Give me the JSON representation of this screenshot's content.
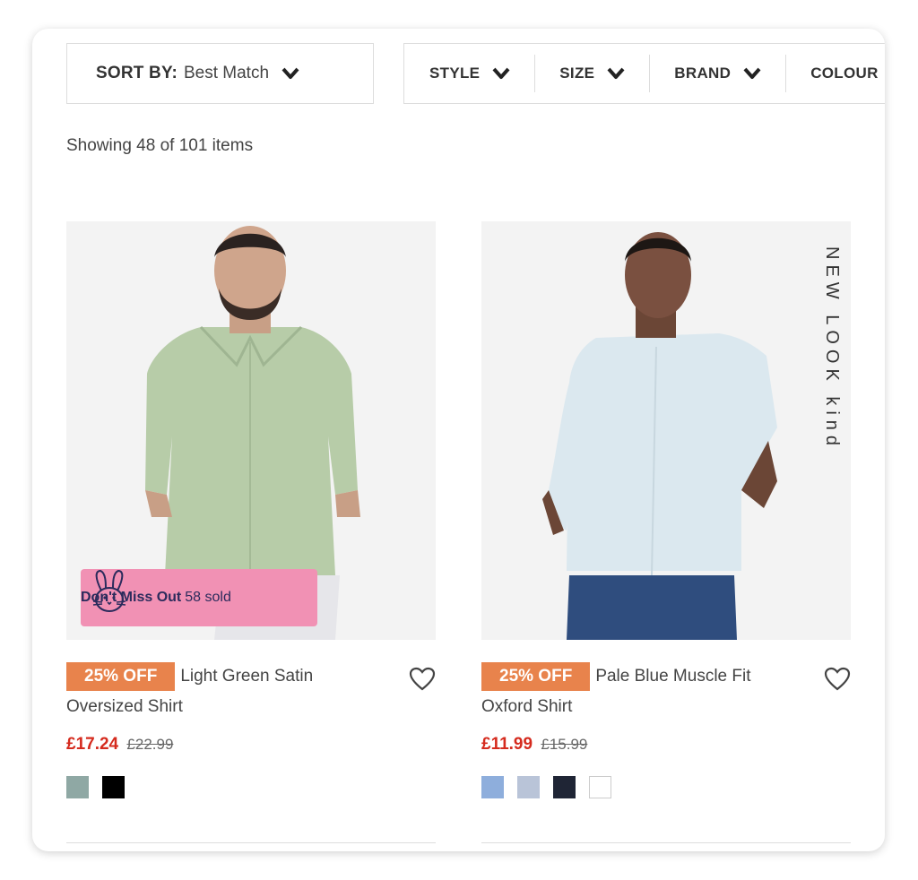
{
  "toolbar": {
    "sort_label": "SORT BY:",
    "sort_value": "Best Match",
    "filters": [
      "STYLE",
      "SIZE",
      "BRAND",
      "COLOUR"
    ]
  },
  "results": {
    "count_text": "Showing 48 of 101 items"
  },
  "products": [
    {
      "badge": "25% OFF",
      "title": "Light Green Satin Oversized Shirt",
      "price": "£17.24",
      "was_price": "£22.99",
      "promo": {
        "bold": "Don't Miss Out",
        "text": "58 sold",
        "icon": "bunny-icon"
      },
      "shirt_color": "#b7cca8",
      "swatches": [
        "#8fa8a4",
        "#000000"
      ]
    },
    {
      "badge": "25% OFF",
      "title": "Pale Blue Muscle Fit Oxford Shirt",
      "price": "£11.99",
      "was_price": "£15.99",
      "brand_tag": "NEW LOOK kind",
      "shirt_color": "#dbe8ef",
      "swatches": [
        "#8eaedc",
        "#b9c4d8",
        "#1f2535",
        "#ffffff"
      ]
    }
  ],
  "colors": {
    "badge": "#e8834c",
    "sale_price": "#d52b1e",
    "promo_bg": "#f191b4"
  }
}
